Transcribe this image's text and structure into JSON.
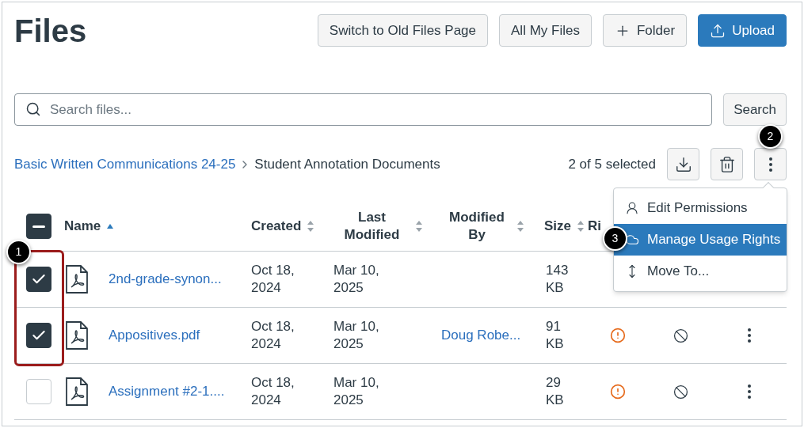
{
  "page": {
    "title": "Files"
  },
  "header_buttons": [
    {
      "label": "Switch to Old Files Page",
      "kind": "plain"
    },
    {
      "label": "All My Files",
      "kind": "plain"
    },
    {
      "label": "Folder",
      "kind": "add"
    },
    {
      "label": "Upload",
      "kind": "upload"
    }
  ],
  "search": {
    "placeholder": "Search files...",
    "button": "Search"
  },
  "breadcrumb": [
    {
      "label": "Basic Written Communications 24-25",
      "kind": "link"
    },
    {
      "label": "Student Annotation Documents",
      "kind": "current"
    }
  ],
  "selection": {
    "text": "2 of 5 selected"
  },
  "toolbar": [
    {
      "kind": "download"
    },
    {
      "kind": "delete"
    },
    {
      "kind": "more"
    }
  ],
  "menu": [
    {
      "label": "Edit Permissions",
      "kind": "permissions",
      "selected": false
    },
    {
      "label": "Manage Usage Rights",
      "kind": "rights",
      "selected": true
    },
    {
      "label": "Move To...",
      "kind": "move",
      "selected": false
    }
  ],
  "table": {
    "select_all_indeterminate": true,
    "columns": [
      {
        "label": "Name",
        "sortable": true,
        "sorted": true
      },
      {
        "label": "Created",
        "sortable": true,
        "sorted": false
      },
      {
        "label": "Last Modified",
        "sortable": true,
        "sorted": false
      },
      {
        "label": "Modified By",
        "sortable": true,
        "sorted": false
      },
      {
        "label": "Size",
        "sortable": true,
        "sorted": false
      },
      {
        "label": "Ri"
      }
    ],
    "rows": [
      {
        "name": "2nd-grade-synon...",
        "created": "Oct 18, 2024",
        "modified": "Mar 10, 2025",
        "size": "143 KB",
        "checked": true,
        "actions_visible": false
      },
      {
        "name": "Appositives.pdf",
        "created": "Oct 18, 2024",
        "modified": "Mar 10, 2025",
        "modified_by": "Doug Robe...",
        "size": "91 KB",
        "checked": true,
        "actions_visible": true
      },
      {
        "name": "Assignment #2-1....",
        "created": "Oct 18, 2024",
        "modified": "Mar 10, 2025",
        "size": "29 KB",
        "checked": false,
        "actions_visible": true
      }
    ]
  },
  "callouts": [
    {
      "label": "1"
    },
    {
      "label": "2"
    },
    {
      "label": "3"
    }
  ]
}
